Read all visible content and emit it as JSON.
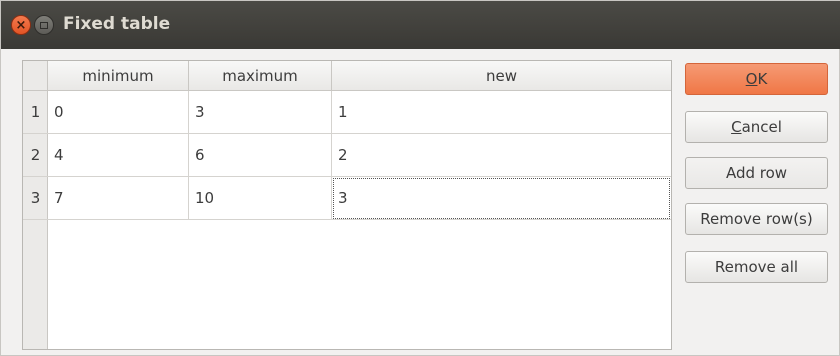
{
  "window": {
    "title": "Fixed table"
  },
  "table": {
    "columns": [
      "minimum",
      "maximum",
      "new"
    ],
    "row_headers": [
      "1",
      "2",
      "3"
    ],
    "rows": [
      [
        "0",
        "3",
        "1"
      ],
      [
        "4",
        "6",
        "2"
      ],
      [
        "7",
        "10",
        "3"
      ]
    ]
  },
  "buttons": {
    "ok": {
      "mnemonic": "O",
      "rest": "K"
    },
    "cancel": {
      "mnemonic": "C",
      "rest": "ancel"
    },
    "add_row": "Add row",
    "remove_rows": "Remove row(s)",
    "remove_all": "Remove all"
  },
  "colors": {
    "accent": "#f07746",
    "titlebar": "#3c3b37"
  }
}
